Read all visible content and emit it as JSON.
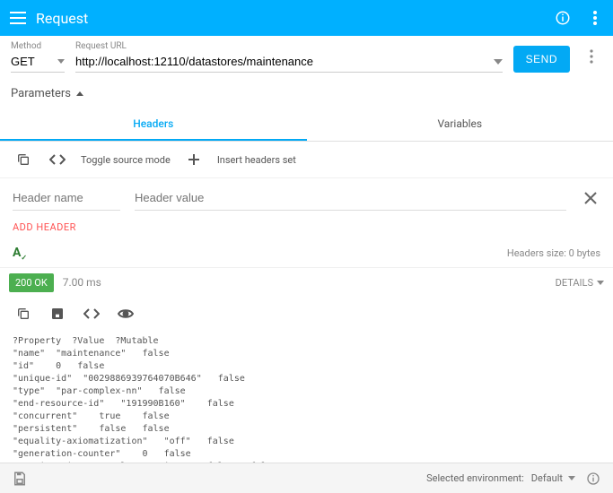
{
  "header": {
    "title": "Request"
  },
  "request": {
    "method_label": "Method",
    "method": "GET",
    "url_label": "Request URL",
    "url": "http://localhost:12110/datastores/maintenance",
    "send_label": "SEND"
  },
  "parameters": {
    "toggle_label": "Parameters",
    "tabs": {
      "headers": "Headers",
      "variables": "Variables"
    },
    "toolbar": {
      "toggle_source": "Toggle source mode",
      "insert_set": "Insert headers set"
    },
    "inputs": {
      "name_placeholder": "Header name",
      "value_placeholder": "Header value"
    },
    "add_header_label": "ADD HEADER",
    "size_label": "Headers size: 0 bytes"
  },
  "response": {
    "status": "200 OK",
    "timing": "7.00 ms",
    "details_label": "DETAILS",
    "body_lines": [
      "?Property  ?Value  ?Mutable",
      "\"name\"  \"maintenance\"   false",
      "\"id\"    0   false",
      "\"unique-id\"  \"0029886939764070B646\"   false",
      "\"type\"  \"par-complex-nn\"   false",
      "\"end-resource-id\"   \"191990B160\"    false",
      "\"concurrent\"    true    false",
      "\"persistent\"    false   false",
      "\"equality-axiomatization\"   \"off\"   false",
      "\"generation-counter\"    0   false",
      "\"requires-incremental-reasoning\"    false   false"
    ]
  },
  "footer": {
    "sel_env_label": "Selected environment:",
    "sel_env_value": "Default"
  }
}
